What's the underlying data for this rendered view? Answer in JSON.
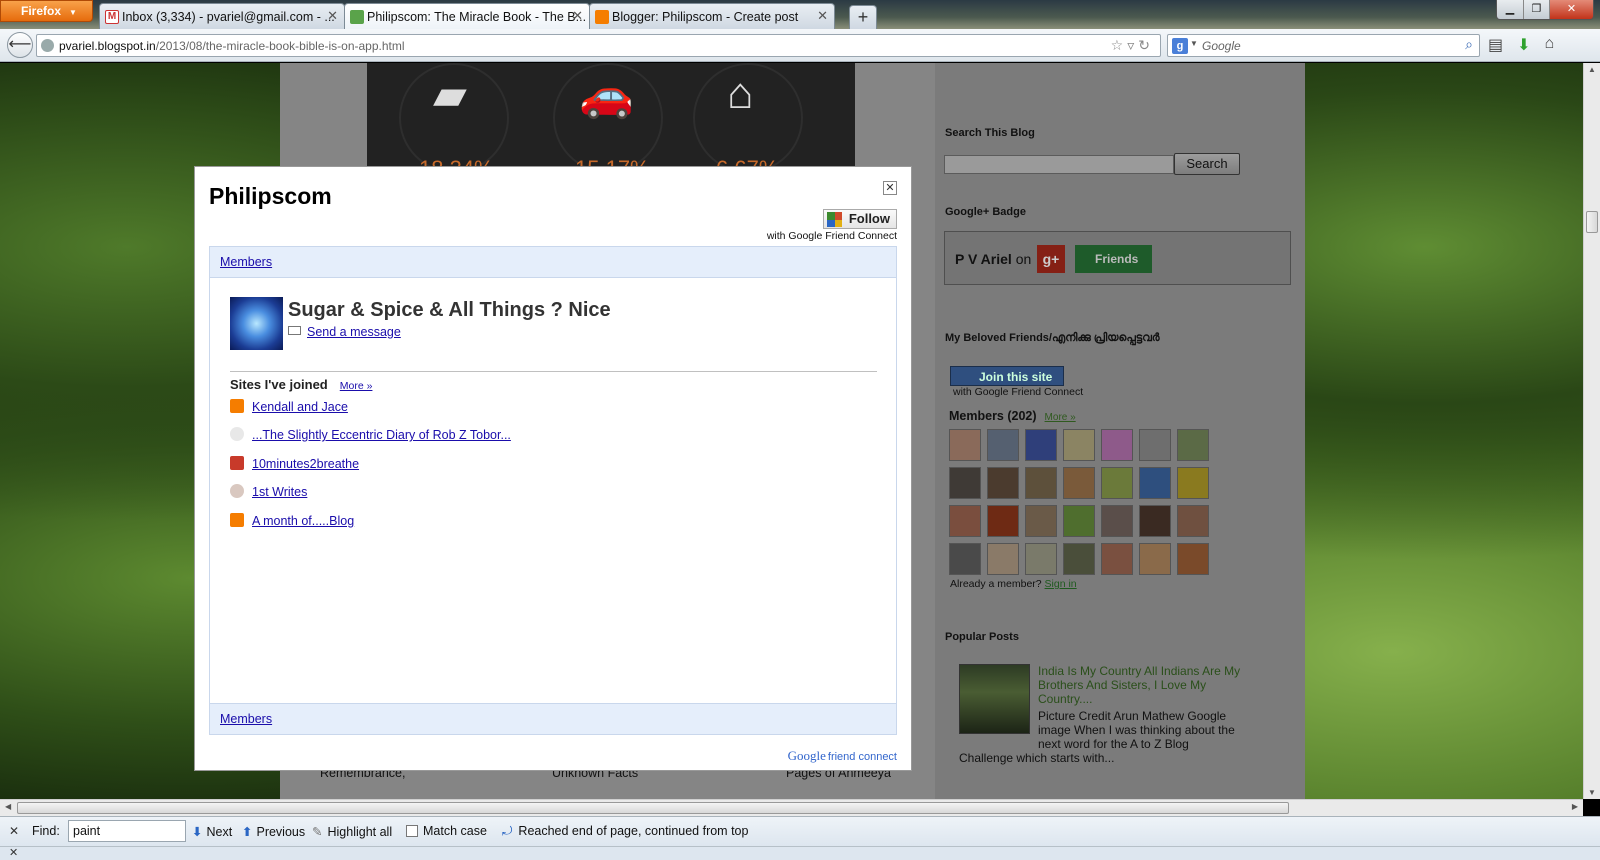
{
  "browser": {
    "app_button": "Firefox",
    "tabs": [
      {
        "title": "Inbox (3,334) - pvariel@gmail.com - ...",
        "icon": "gmail-icon",
        "active": false
      },
      {
        "title": "Philipscom: The Miracle Book - The B...",
        "icon": "leaf-icon",
        "active": true
      },
      {
        "title": "Blogger: Philipscom - Create post",
        "icon": "blogger-icon",
        "active": false
      }
    ],
    "url_domain": "pvariel.blogspot.in",
    "url_path": "/2013/08/the-miracle-book-bible-is-on-app.html",
    "search_placeholder": "Google"
  },
  "background_page": {
    "stats": [
      "18.34%",
      "15.17%",
      "6.67%"
    ],
    "sidebar": {
      "search_heading": "Search This Blog",
      "search_button": "Search",
      "badge_heading": "Google+ Badge",
      "badge_name": "P V Ariel",
      "badge_on": "on",
      "badge_friends": "Friends",
      "friends_heading": "My Beloved Friends/എനിക്കു പ്രിയപ്പെട്ടവർ",
      "join_button": "Join this site",
      "join_sub": "with Google Friend Connect",
      "members_label": "Members (202)",
      "members_more": "More »",
      "already_text": "Already a member?",
      "sign_in": "Sign in",
      "popular_heading": "Popular Posts",
      "popular_title": "India Is My Country All Indians Are My Brothers And Sisters, I Love My Country....",
      "popular_text": "Picture Credit Arun Mathew Google image When I was thinking about the next word for the A to Z Blog",
      "popular_text2": "Challenge which starts with..."
    },
    "bottom_links": [
      "Remembrance,",
      "Unknown Facts",
      "Pages of Anmeeya"
    ]
  },
  "modal": {
    "title": "Philipscom",
    "follow_button": "Follow",
    "follow_sub": "with Google Friend Connect",
    "members_link": "Members",
    "profile_name": "Sugar & Spice & All Things ? Nice",
    "send_message": "Send a message",
    "sites_heading": "Sites I've joined",
    "sites_more": "More »",
    "sites": [
      {
        "label": "Kendall and Jace",
        "icon": "blogger-icon"
      },
      {
        "label": "...The Slightly Eccentric Diary of Rob Z Tobor...",
        "icon": "skull-icon"
      },
      {
        "label": "10minutes2breathe",
        "icon": "flower-icon"
      },
      {
        "label": "1st Writes",
        "icon": "writes-icon"
      },
      {
        "label": "A month of.....Blog",
        "icon": "blogger-icon"
      }
    ],
    "footer_members_link": "Members",
    "brand_google": "Google",
    "brand_fc": "friend connect"
  },
  "findbar": {
    "label": "Find:",
    "query": "paint",
    "next": "Next",
    "previous": "Previous",
    "highlight_all": "Highlight all",
    "match_case": "Match case",
    "status": "Reached end of page, continued from top"
  },
  "colors": {
    "firefox_orange": "#e66b0c",
    "link_blue": "#1a0dab",
    "gfc_strip": "#e5eefb"
  }
}
